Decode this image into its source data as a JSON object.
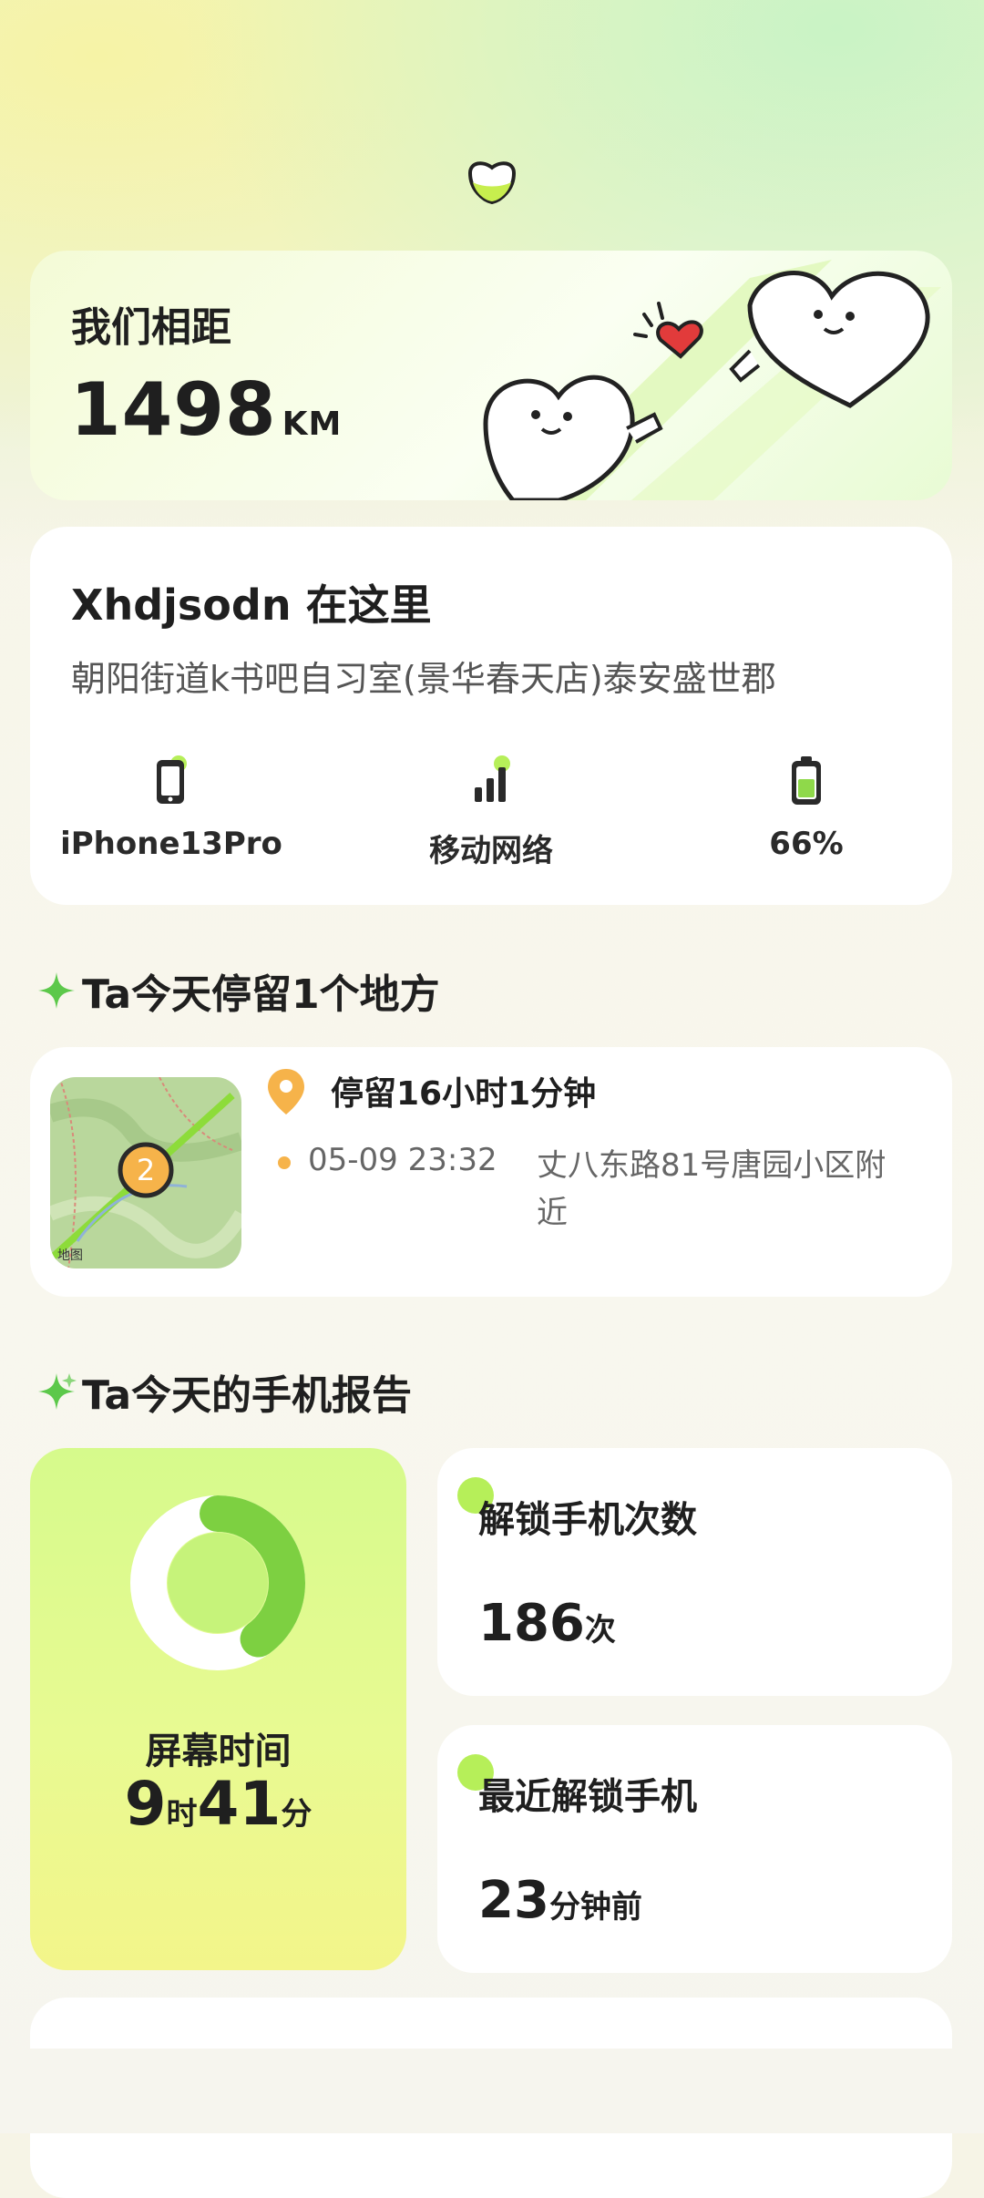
{
  "distance": {
    "title": "我们相距",
    "value": "1498",
    "unit": "KM"
  },
  "location": {
    "name": "Xhdjsodn 在这里",
    "address": "朝阳街道k书吧自习室(景华春天店)泰安盛世郡",
    "stats": [
      {
        "icon": "phone-icon",
        "label": "iPhone13Pro"
      },
      {
        "icon": "signal-icon",
        "label": "移动网络"
      },
      {
        "icon": "battery-icon",
        "label": "66%"
      }
    ]
  },
  "stay_section": {
    "title": "Ta今天停留1个地方"
  },
  "stay": {
    "duration": "停留16小时1分钟",
    "time": "05-09 23:32",
    "place": "丈八东路81号唐园小区附近",
    "map_label": "地图",
    "map_marker": "2"
  },
  "report_section": {
    "title": "Ta今天的手机报告"
  },
  "screen_time": {
    "label": "屏幕时间",
    "hours": "9",
    "hours_unit": "时",
    "minutes": "41",
    "minutes_unit": "分",
    "progress": 0.4
  },
  "unlock_count": {
    "title": "解锁手机次数",
    "value": "186",
    "unit": "次"
  },
  "last_unlock": {
    "title": "最近解锁手机",
    "value": "23",
    "unit": "分钟前"
  },
  "colors": {
    "accent": "#8fd94a",
    "ring_fill": "#7dd041",
    "pin": "#f6b34a"
  }
}
